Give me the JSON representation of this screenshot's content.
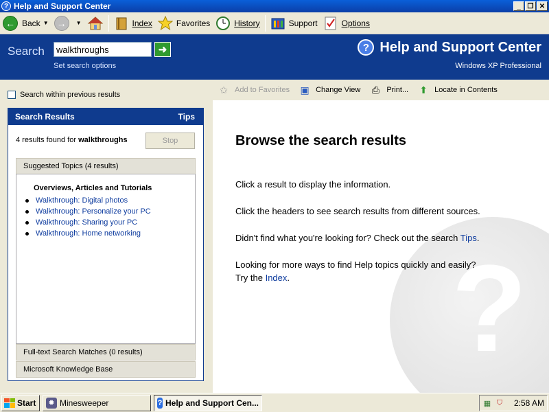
{
  "window": {
    "title": "Help and Support Center",
    "controls": {
      "minimize": "_",
      "restore": "❐",
      "close": "✕"
    }
  },
  "toolbar": {
    "back": "Back",
    "index": "Index",
    "favorites": "Favorites",
    "history": "History",
    "support": "Support",
    "options": "Options"
  },
  "header": {
    "search_label": "Search",
    "search_value": "walkthroughs",
    "set_search_options": "Set search options",
    "brand_title": "Help and Support Center",
    "edition": "Windows XP Professional",
    "colors": {
      "band": "#0f3b8e"
    }
  },
  "left": {
    "search_within": "Search within previous results",
    "results_title": "Search Results",
    "tips": "Tips",
    "found_prefix": "4 results found for ",
    "found_query": "walkthroughs",
    "stop": "Stop",
    "suggested_header": "Suggested Topics (4 results)",
    "group_title": "Overviews, Articles and Tutorials",
    "topics": [
      "Walkthrough: Digital photos",
      "Walkthrough: Personalize your PC",
      "Walkthrough: Sharing your PC",
      "Walkthrough: Home networking"
    ],
    "fulltext_header": "Full-text Search Matches (0 results)",
    "kb_header": "Microsoft Knowledge Base"
  },
  "right": {
    "tools": {
      "add_to_favorites": "Add to Favorites",
      "change_view": "Change View",
      "print": "Print...",
      "locate": "Locate in Contents"
    },
    "title": "Browse the search results",
    "p1": "Click a result to display the information.",
    "p2": "Click the headers to see search results from different sources.",
    "p3_prefix": "Didn't find what you're looking for? Check out the search ",
    "p3_link": "Tips",
    "p3_suffix": ".",
    "p4_line1": "Looking for more ways to find Help topics quickly and easily?",
    "p4_prefix": "Try the ",
    "p4_link": "Index",
    "p4_suffix": "."
  },
  "taskbar": {
    "start": "Start",
    "tasks": [
      "Minesweeper",
      "Help and Support Cen..."
    ],
    "clock": "2:58 AM"
  }
}
